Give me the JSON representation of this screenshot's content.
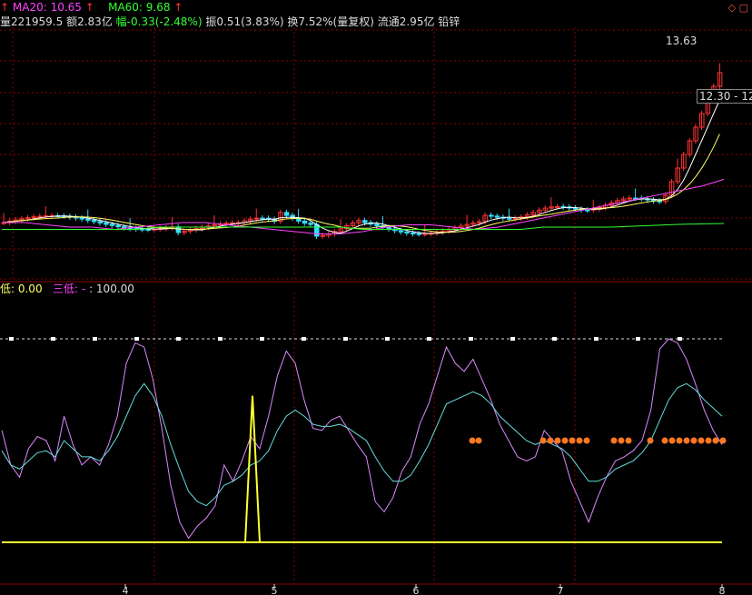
{
  "header": {
    "ma20_label": "MA20: 10.65",
    "ma60_label": "MA60: 9.68",
    "volume": "量221959.5",
    "amount": "额2.83亿",
    "change": "幅-0.33(-2.48%)",
    "amplitude": "振0.51(3.83%)",
    "turnover": "换7.52%(量复权)",
    "float": "流通2.95亿",
    "sector": "铅锌",
    "up_arrow": "↑",
    "top_icons": "◇ ▢"
  },
  "indicator_header": {
    "low_label": "低: 0.00",
    "san_label": "三低: -",
    "max_label": ": 100.00"
  },
  "price_tags": {
    "high": "13.63",
    "current": "12.30 - 12"
  },
  "colors": {
    "background": "#000000",
    "grid": "#8b0000",
    "up_candle": "#ff3333",
    "down_candle": "#33ddff",
    "ma_white": "#ffffff",
    "ma_yellow": "#ffff66",
    "ma20": "#ff44ff",
    "ma60": "#33ff33",
    "indicator_violet": "#dd88ff",
    "indicator_cyan": "#66dddd",
    "indicator_yellow": "#ffff33",
    "signal_dots": "#ff7722"
  },
  "chart_data": [
    {
      "type": "line",
      "x_ticks": [
        "4",
        "5",
        "6",
        "7",
        "8"
      ],
      "series": [
        {
          "name": "MA20",
          "values": [
            9.7,
            9.7,
            9.65,
            9.6,
            9.6,
            9.55,
            9.6,
            9.65,
            9.7,
            9.7,
            9.65,
            9.6,
            9.55,
            9.5,
            9.45,
            9.45,
            9.5,
            9.6,
            9.65,
            9.65,
            9.6,
            9.55,
            9.6,
            9.7,
            9.8,
            9.9,
            10.0,
            10.1,
            10.2,
            10.3,
            10.4,
            10.5,
            10.65
          ]
        },
        {
          "name": "MA60",
          "values": [
            9.55,
            9.55,
            9.55,
            9.55,
            9.55,
            9.55,
            9.55,
            9.6,
            9.6,
            9.6,
            9.6,
            9.6,
            9.6,
            9.6,
            9.6,
            9.6,
            9.55,
            9.55,
            9.55,
            9.55,
            9.55,
            9.55,
            9.55,
            9.55,
            9.6,
            9.6,
            9.6,
            9.6,
            9.62,
            9.64,
            9.66,
            9.67,
            9.68
          ]
        }
      ],
      "price_high": 13.63,
      "price_current": 12.3
    },
    {
      "type": "line",
      "ylim": [
        0,
        100
      ],
      "series": [
        {
          "name": "",
          "values": [
            55,
            38,
            32,
            46,
            52,
            50,
            40,
            62,
            48,
            38,
            42,
            38,
            48,
            62,
            88,
            98,
            96,
            80,
            56,
            28,
            10,
            2,
            8,
            12,
            18,
            38,
            30,
            40,
            52,
            46,
            62,
            82,
            94,
            88,
            70,
            56,
            55,
            60,
            62,
            55,
            48,
            42,
            20,
            15,
            22,
            35,
            42,
            58,
            68,
            82,
            96,
            88,
            84,
            90,
            80,
            70,
            58,
            50,
            42,
            40,
            42,
            55,
            50,
            45,
            30,
            20,
            10,
            22,
            32,
            40,
            42,
            45,
            50,
            65,
            95,
            100,
            98,
            90,
            78,
            65,
            55,
            48
          ]
        },
        {
          "name": "",
          "values": [
            45,
            38,
            36,
            40,
            44,
            45,
            42,
            50,
            46,
            42,
            42,
            40,
            45,
            52,
            62,
            72,
            78,
            72,
            62,
            48,
            36,
            25,
            20,
            18,
            22,
            28,
            30,
            33,
            38,
            40,
            45,
            55,
            62,
            65,
            62,
            58,
            57,
            57,
            58,
            56,
            53,
            50,
            42,
            35,
            30,
            30,
            33,
            40,
            48,
            58,
            68,
            70,
            72,
            74,
            72,
            68,
            62,
            58,
            54,
            50,
            48,
            50,
            48,
            46,
            42,
            36,
            30,
            30,
            32,
            36,
            38,
            40,
            44,
            50,
            60,
            70,
            76,
            78,
            75,
            70,
            66,
            62
          ]
        },
        {
          "name": "",
          "values": [
            0,
            0,
            0,
            0,
            0,
            0,
            0,
            0,
            0,
            0,
            0,
            0,
            0,
            0,
            0,
            0,
            0,
            0,
            0,
            0,
            0,
            0,
            0,
            0,
            0,
            0,
            0,
            0,
            0,
            0,
            0,
            0,
            0,
            0,
            0,
            0,
            0,
            0,
            0,
            0,
            0,
            0,
            0,
            0,
            0,
            0,
            0,
            0,
            0,
            0,
            0,
            0,
            0,
            0,
            0,
            0,
            0,
            0,
            0,
            0,
            0,
            0,
            0,
            0,
            0,
            0,
            0,
            0,
            0,
            0,
            0,
            0,
            0,
            0,
            0,
            0,
            0,
            0,
            0,
            0,
            0,
            0
          ]
        }
      ],
      "spike_value": 72,
      "reference_line": 100
    }
  ]
}
